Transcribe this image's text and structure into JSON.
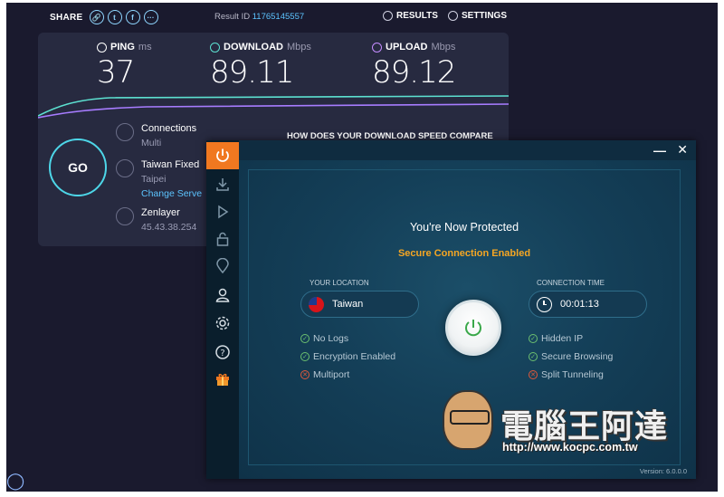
{
  "speedtest": {
    "share_label": "SHARE",
    "result_label": "Result ID",
    "result_id": "11765145557",
    "results_label": "RESULTS",
    "settings_label": "SETTINGS",
    "ping": {
      "label": "PING",
      "unit": "ms",
      "value": "37"
    },
    "download": {
      "label": "DOWNLOAD",
      "unit": "Mbps",
      "value": "89.11"
    },
    "upload": {
      "label": "UPLOAD",
      "unit": "Mbps",
      "value": "89.12"
    },
    "go_label": "GO",
    "connections": {
      "title": "Connections",
      "value": "Multi"
    },
    "isp": {
      "title": "Taiwan Fixed",
      "city": "Taipei",
      "change": "Change Serve"
    },
    "host": {
      "title": "Zenlayer",
      "ip": "45.43.38.254"
    },
    "compare_heading": "HOW DOES YOUR DOWNLOAD SPEED COMPARE"
  },
  "vpn": {
    "status_title": "You're Now Protected",
    "status_sub": "Secure Connection Enabled",
    "location_label": "YOUR LOCATION",
    "location_value": "Taiwan",
    "time_label": "CONNECTION TIME",
    "time_value": "00:01:13",
    "features_left": [
      {
        "label": "No Logs",
        "enabled": true
      },
      {
        "label": "Encryption Enabled",
        "enabled": true
      },
      {
        "label": "Multiport",
        "enabled": false
      }
    ],
    "features_right": [
      {
        "label": "Hidden IP",
        "enabled": true
      },
      {
        "label": "Secure Browsing",
        "enabled": true
      },
      {
        "label": "Split Tunneling",
        "enabled": false
      }
    ],
    "version": "Version: 6.0.0.0",
    "accent_color": "#f07820",
    "ok_color": "#6cc070",
    "off_color": "#e0583a",
    "sidebar_icons": [
      "power-icon",
      "download-icon",
      "play-icon",
      "lock-icon",
      "ip-icon",
      "user-icon",
      "gear-icon",
      "help-icon",
      "gift-icon"
    ]
  },
  "watermark": {
    "title": "電腦王阿達",
    "url": "http://www.kocpc.com.tw"
  }
}
